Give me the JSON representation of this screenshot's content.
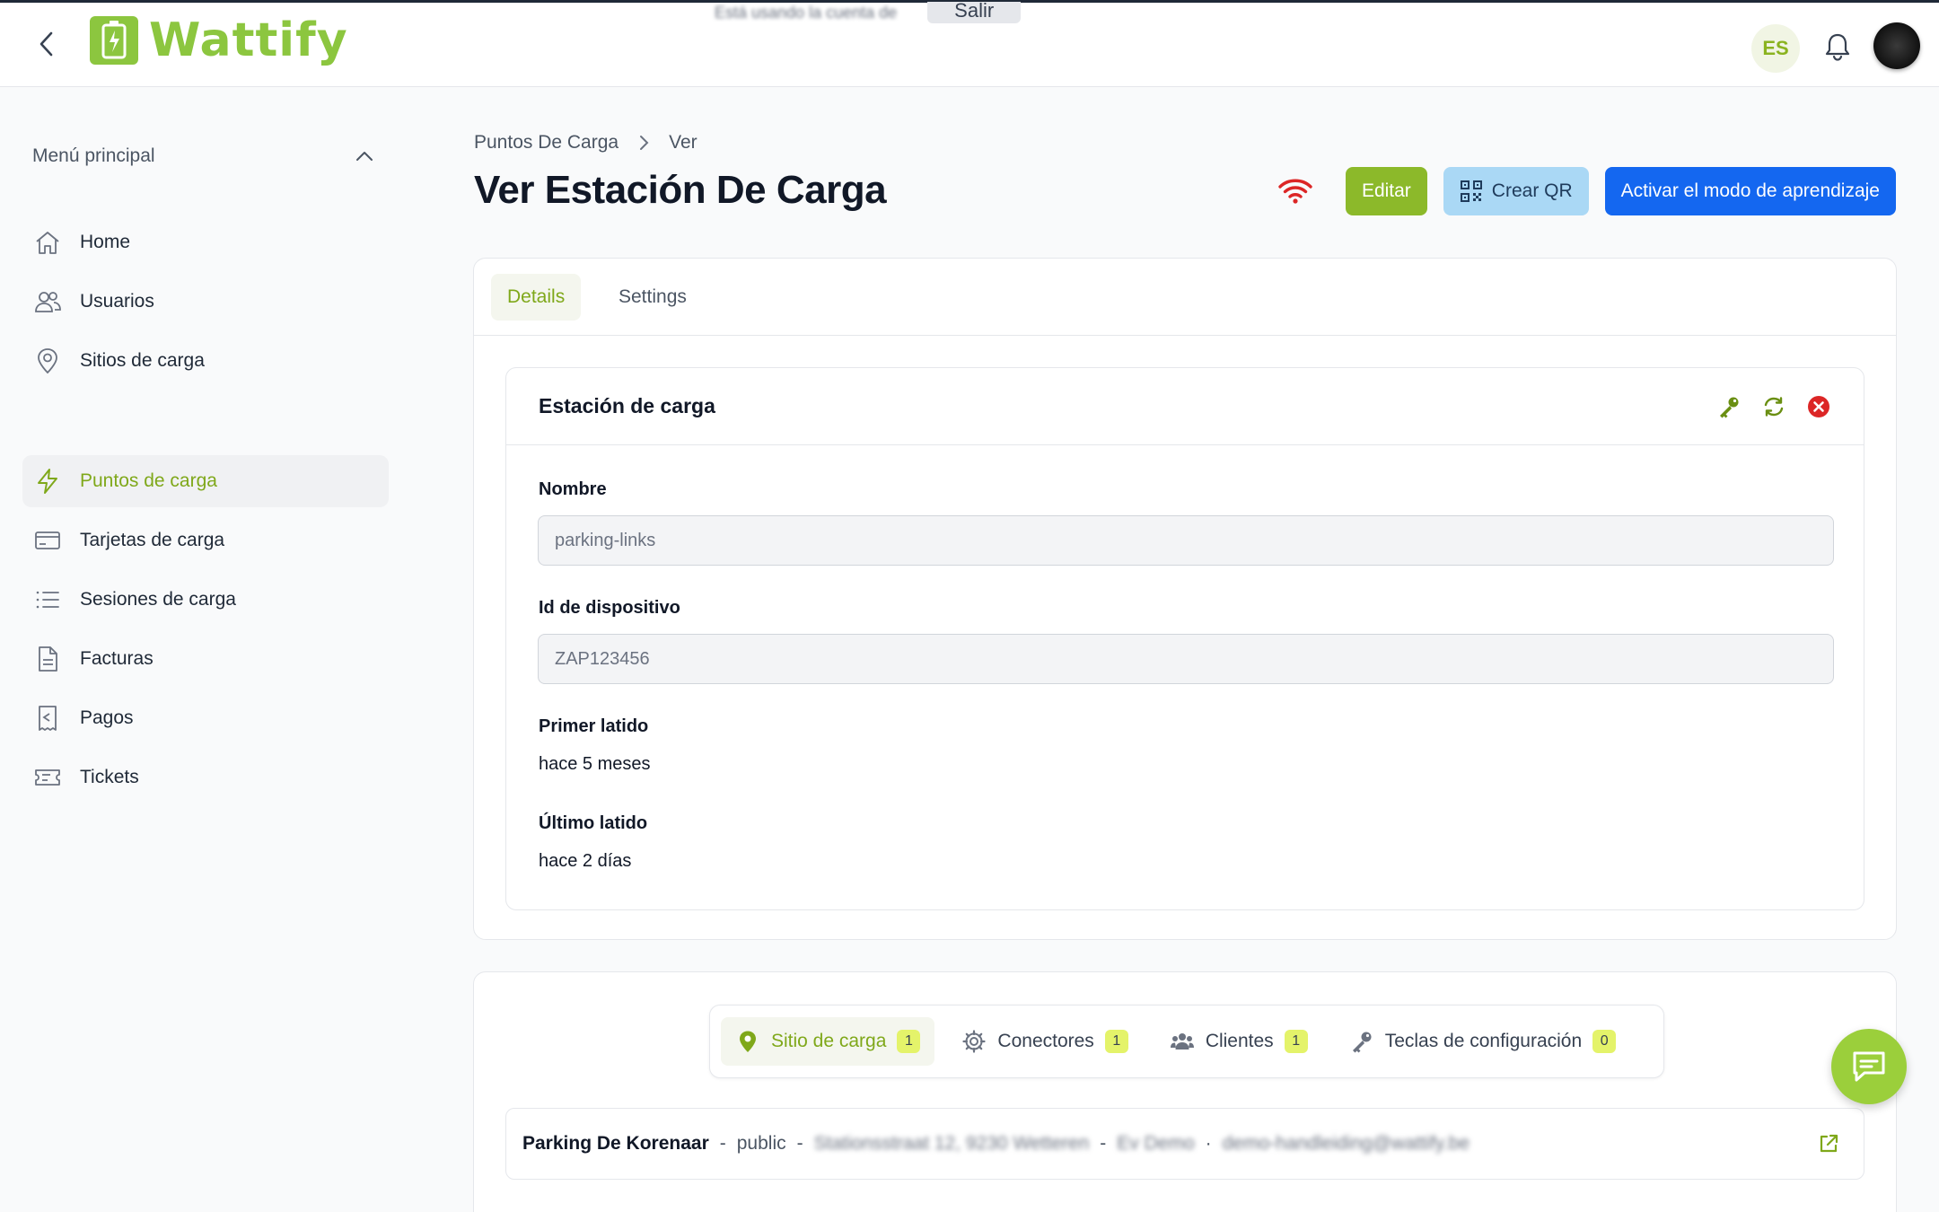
{
  "app": {
    "name": "Wattify",
    "brand_color": "#8cc63f",
    "accent_blue": "#1467f0"
  },
  "banner": {
    "text": "Está usando la cuenta de",
    "button": "Salir"
  },
  "header": {
    "language": "ES"
  },
  "sidebar": {
    "menu_title": "Menú principal",
    "items": [
      {
        "label": "Home",
        "icon": "home-icon"
      },
      {
        "label": "Usuarios",
        "icon": "users-icon"
      },
      {
        "label": "Sitios de carga",
        "icon": "map-pin-icon"
      },
      {
        "label": "Puntos de carga",
        "icon": "bolt-icon",
        "active": true
      },
      {
        "label": "Tarjetas de carga",
        "icon": "credit-card-icon"
      },
      {
        "label": "Sesiones de carga",
        "icon": "list-icon"
      },
      {
        "label": "Facturas",
        "icon": "document-icon"
      },
      {
        "label": "Pagos",
        "icon": "receipt-icon"
      },
      {
        "label": "Tickets",
        "icon": "ticket-icon"
      }
    ]
  },
  "breadcrumb": {
    "parent": "Puntos De Carga",
    "current": "Ver"
  },
  "page": {
    "title": "Ver Estación De Carga"
  },
  "actions": {
    "edit": "Editar",
    "qr": "Crear QR",
    "learn": "Activar el modo de aprendizaje"
  },
  "tabs": {
    "details": "Details",
    "settings": "Settings"
  },
  "station": {
    "title": "Estación de carga",
    "name_label": "Nombre",
    "name_value": "parking-links",
    "device_label": "Id de dispositivo",
    "device_value": "ZAP123456",
    "first_label": "Primer latido",
    "first_value": "hace 5 meses",
    "last_label": "Último latido",
    "last_value": "hace 2 días"
  },
  "relations": {
    "tabs": [
      {
        "label": "Sitio de carga",
        "count": "1"
      },
      {
        "label": "Conectores",
        "count": "1"
      },
      {
        "label": "Clientes",
        "count": "1"
      },
      {
        "label": "Teclas de configuración",
        "count": "0"
      }
    ],
    "site": {
      "name": "Parking De Korenaar",
      "visibility": "public",
      "address": "Stationsstraat 12, 9230 Wetteren",
      "owner": "Ev Demo",
      "email": "demo-handleiding@wattify.be"
    }
  }
}
